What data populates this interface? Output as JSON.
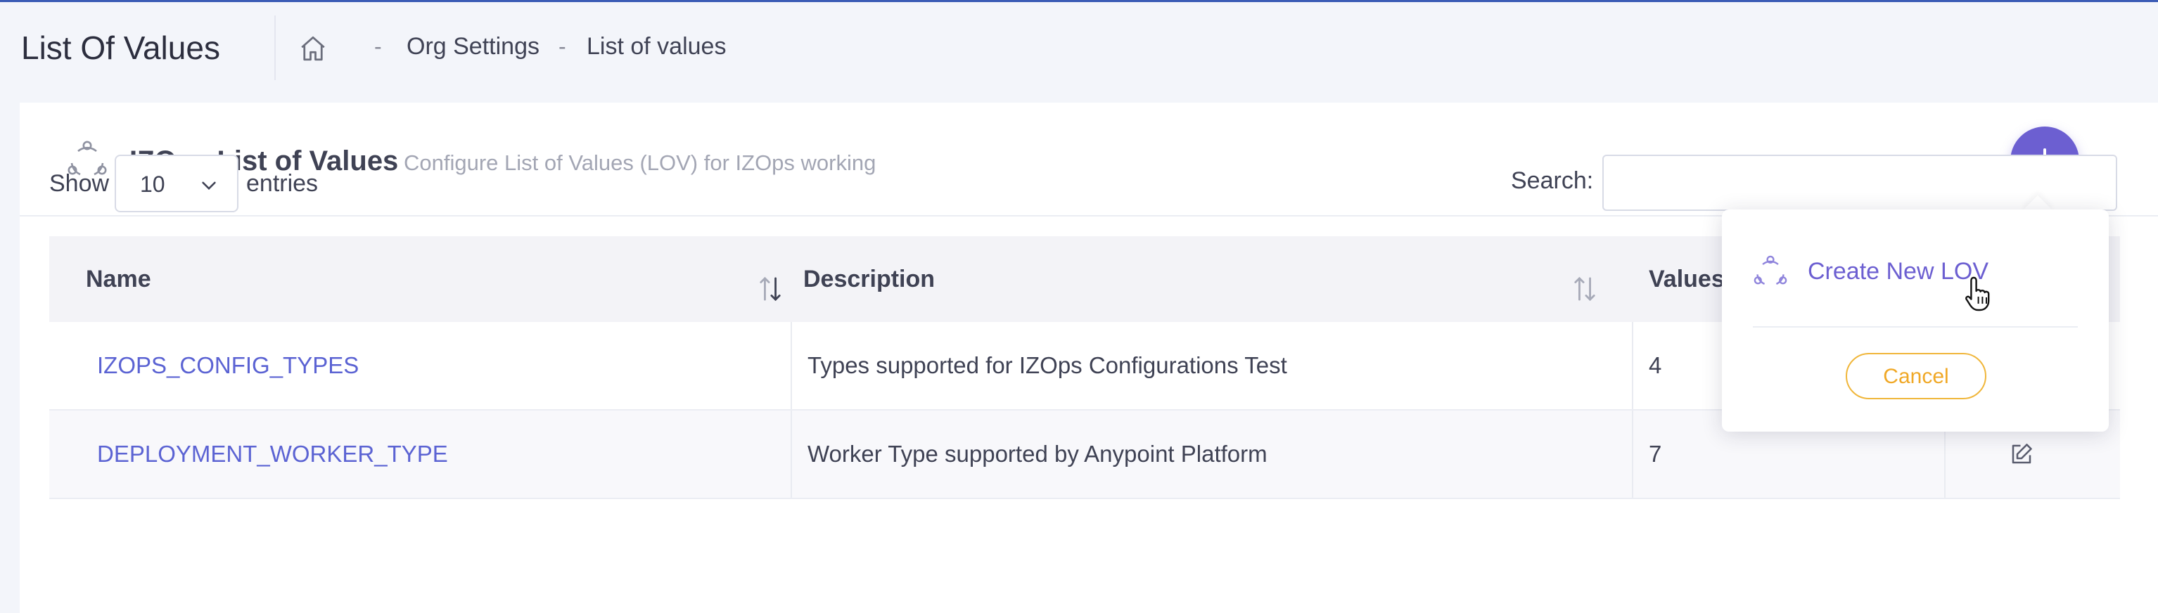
{
  "header": {
    "title": "List Of Values",
    "breadcrumb_sep": "-",
    "breadcrumbs": [
      "Org Settings",
      "List of values"
    ]
  },
  "card": {
    "title": "IZOps List of Values",
    "subtitle": "Configure List of Values (LOV) for IZOps working",
    "add_icon": "plus-icon"
  },
  "controls": {
    "show_label": "Show",
    "entries_value": "10",
    "entries_label": "entries",
    "search_label": "Search:",
    "search_value": ""
  },
  "table": {
    "columns": [
      "Name",
      "Description",
      "Values"
    ],
    "rows": [
      {
        "name": "IZOPS_CONFIG_TYPES",
        "description": "Types supported for IZOps Configurations Test",
        "values": "4"
      },
      {
        "name": "DEPLOYMENT_WORKER_TYPE",
        "description": "Worker Type supported by Anypoint Platform",
        "values": "7"
      }
    ]
  },
  "popover": {
    "create_label": "Create New LOV",
    "cancel_label": "Cancel"
  },
  "colors": {
    "accent": "#6c5fd1",
    "link": "#5b63d3",
    "warning": "#f0b63a"
  }
}
